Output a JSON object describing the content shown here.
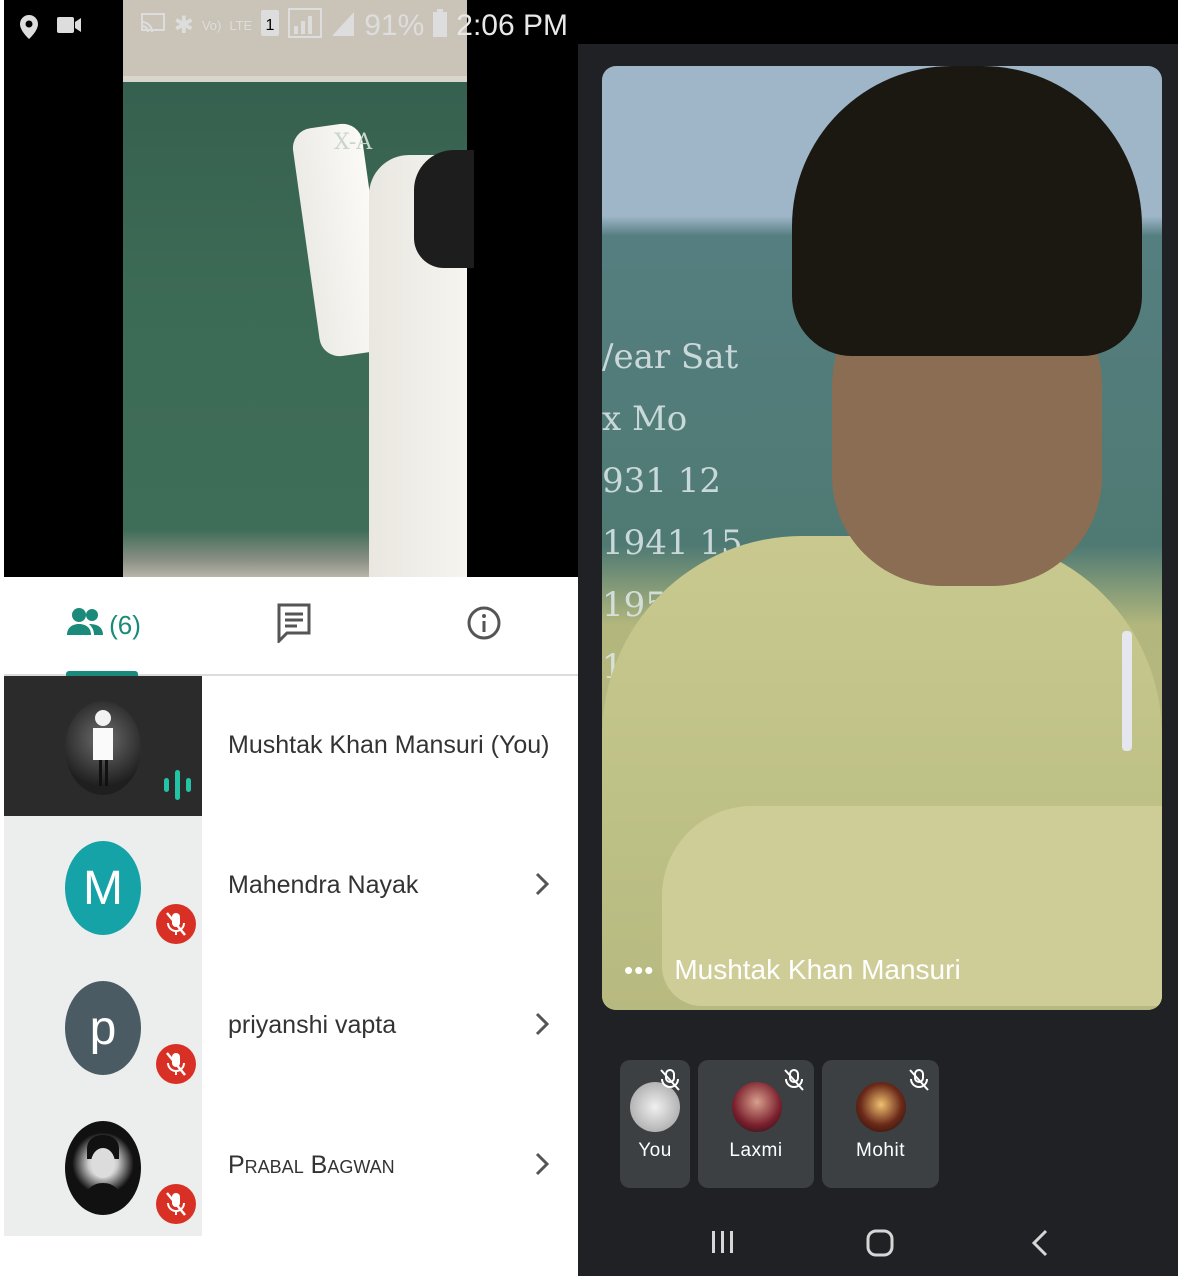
{
  "status_bar": {
    "signal_labels": [
      "Vo)",
      "LTE",
      "LTE"
    ],
    "battery_text": "91%",
    "time": "2:06 PM"
  },
  "main_video": {
    "chalk_text": "X-A"
  },
  "tabs": {
    "people_count": "(6)"
  },
  "participants": [
    {
      "name": "Mushtak Khan Mansuri (You)",
      "initial": "",
      "avatar_color": "#1f1f1f",
      "muted": false,
      "speaking": true
    },
    {
      "name": "Mahendra Nayak",
      "initial": "M",
      "avatar_color": "#16a3a8",
      "muted": true
    },
    {
      "name": "priyanshi vapta",
      "initial": "p",
      "avatar_color": "#4b5b63",
      "muted": true
    },
    {
      "name": "Prabal Bagwan",
      "initial": "",
      "avatar_color": "#111111",
      "muted": true
    }
  ],
  "right_call": {
    "speaker_name": "Mushtak Khan Mansuri",
    "board_text": [
      "/ear   Sat",
      "x       Mo",
      "931   12",
      "1941   15",
      "1951   20",
      "196"
    ],
    "tiles": [
      {
        "name": "You",
        "avatar_color": "#c9c9c9"
      },
      {
        "name": "Laxmi",
        "avatar_color": "#7a1f2d"
      },
      {
        "name": "Mohit",
        "avatar_color": "#6b2a1a"
      }
    ]
  },
  "colors": {
    "accent": "#1a8a7a",
    "mic_off_red": "#d93025",
    "dark_bg": "#202124",
    "tile_bg": "#3c4043"
  }
}
